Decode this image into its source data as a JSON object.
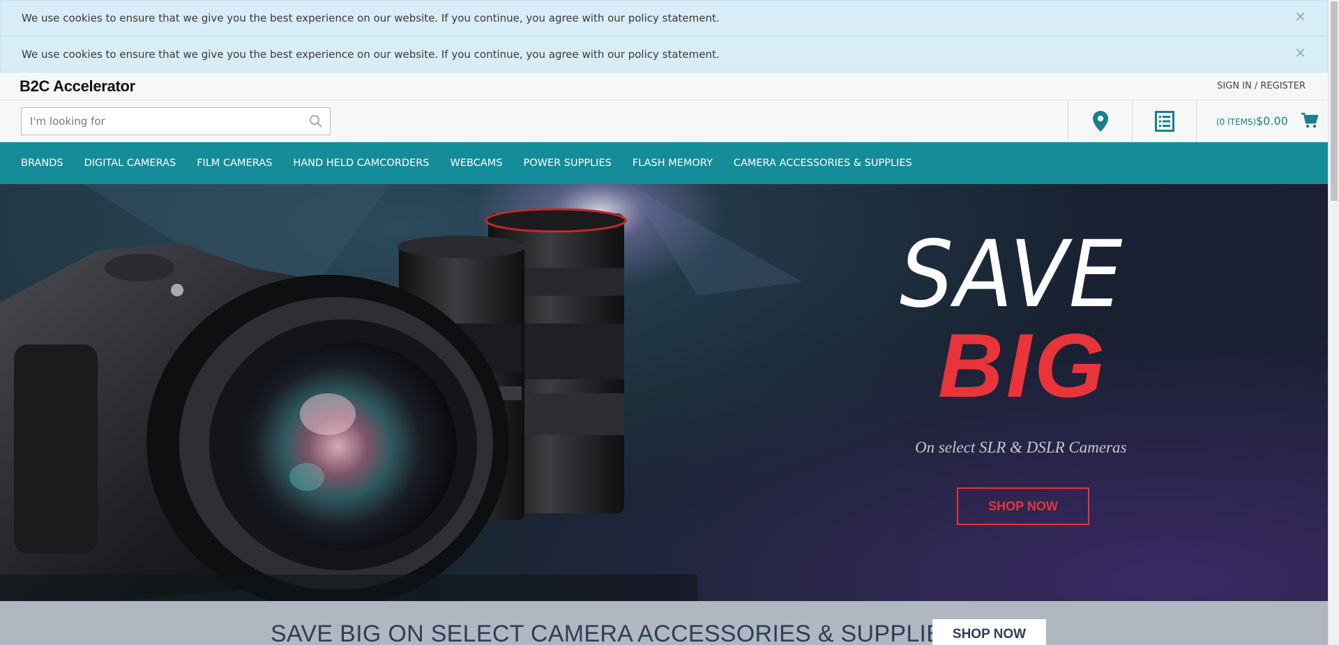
{
  "cookie_notices": [
    {
      "message": "We use cookies to ensure that we give you the best experience on our website. If you continue, you agree with our policy statement.",
      "close": "×"
    },
    {
      "message": "We use cookies to ensure that we give you the best experience on our website. If you continue, you agree with our policy statement.",
      "close": "×"
    }
  ],
  "header": {
    "logo": "B2C Accelerator",
    "sign_in": "SIGN IN / REGISTER",
    "search_placeholder": "I'm looking for",
    "store_finder_icon": "map-marker-icon",
    "quick_order_icon": "list-icon",
    "cart": {
      "items": "(0 ITEMS)",
      "total": "$0.00",
      "icon": "shopping-cart-icon"
    }
  },
  "nav": {
    "items": [
      "BRANDS",
      "DIGITAL CAMERAS",
      "FILM CAMERAS",
      "HAND HELD CAMCORDERS",
      "WEBCAMS",
      "POWER SUPPLIES",
      "FLASH MEMORY",
      "CAMERA ACCESSORIES & SUPPLIES"
    ]
  },
  "hero": {
    "headline_1": "SAVE",
    "headline_2": "BIG",
    "subtext": "On select SLR & DSLR Cameras",
    "button": "SHOP NOW"
  },
  "promo": {
    "text": "SAVE BIG ON SELECT CAMERA ACCESSORIES & SUPPLIES",
    "button": "SHOP NOW"
  },
  "colors": {
    "cookie_bg": "#d9edf7",
    "nav_bg": "#158c99",
    "accent": "#16808f",
    "hero_red": "#e8353a",
    "promo_bg": "#b1b7c0"
  }
}
